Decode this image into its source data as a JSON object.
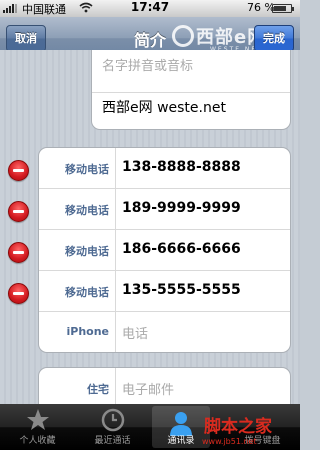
{
  "status_bar": {
    "carrier": "中国联通",
    "time": "17:47",
    "battery_percent": "76 %",
    "battery_level": 0.76
  },
  "nav": {
    "cancel_label": "取消",
    "title": "简介",
    "done_label": "完成"
  },
  "watermark_top": {
    "text": "西部e网",
    "url": "WESTE.NET"
  },
  "name_card": {
    "phonetic_placeholder": "名字拼音或音标",
    "company": "西部e网 weste.net"
  },
  "phones": [
    {
      "label": "移动电话",
      "value": "138-8888-8888"
    },
    {
      "label": "移动电话",
      "value": "189-9999-9999"
    },
    {
      "label": "移动电话",
      "value": "186-6666-6666"
    },
    {
      "label": "移动电话",
      "value": "135-5555-5555"
    }
  ],
  "new_phone": {
    "label": "iPhone",
    "placeholder": "电话"
  },
  "email": {
    "label": "住宅",
    "placeholder": "电子邮件"
  },
  "tabs": [
    {
      "label": "个人收藏",
      "icon": "star-icon"
    },
    {
      "label": "最近通话",
      "icon": "clock-icon"
    },
    {
      "label": "通讯录",
      "icon": "contacts-icon"
    },
    {
      "label": "拨号键盘",
      "icon": "keypad-icon"
    }
  ],
  "watermark_bottom": {
    "text": "脚本之家",
    "url": "www.jb51.net"
  },
  "colors": {
    "nav_bar": "#7b8fa9",
    "done_button": "#2a66d2",
    "delete_red": "#d2191f",
    "label_blue": "#4e6a92"
  }
}
